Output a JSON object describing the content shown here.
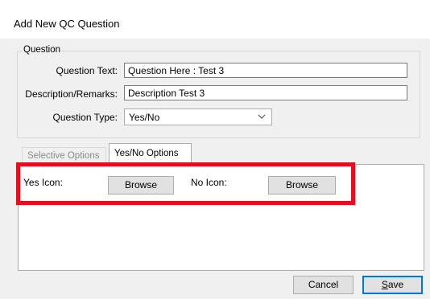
{
  "window": {
    "title": "Add New QC Question"
  },
  "question_group": {
    "legend": "Question",
    "question_text_label": "Question Text:",
    "question_text_value": "Question Here : Test 3",
    "description_label": "Description/Remarks:",
    "description_value": "Description Test 3",
    "question_type_label": "Question Type:",
    "question_type_value": "Yes/No"
  },
  "tabs": [
    {
      "label": "Selective Options",
      "active": false
    },
    {
      "label": "Yes/No Options",
      "active": true
    }
  ],
  "yes_no_options": {
    "yes_icon_label": "Yes Icon:",
    "yes_browse_label": "Browse",
    "no_icon_label": "No Icon:",
    "no_browse_label": "Browse"
  },
  "footer": {
    "cancel_label": "Cancel",
    "save_label_first": "S",
    "save_label_rest": "ave"
  },
  "icons": {
    "dropdown": "chevron-down-icon"
  },
  "colors": {
    "highlight": "#e30f1e",
    "focus": "#0078d7"
  }
}
